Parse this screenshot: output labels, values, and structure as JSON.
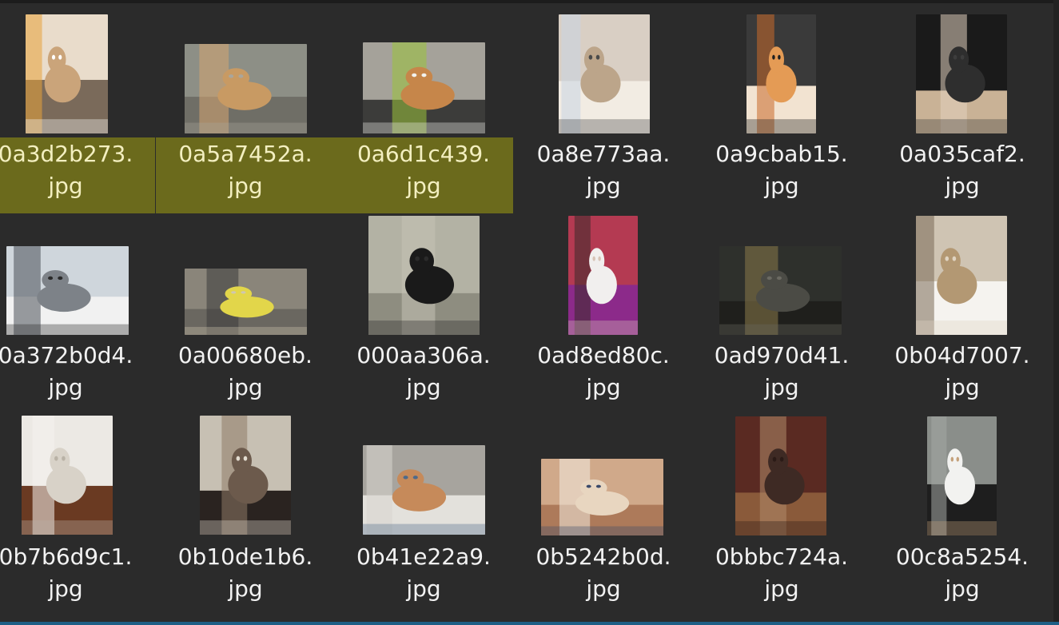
{
  "file_grid": {
    "selection_color": "#6b6a1c",
    "items": [
      {
        "name_line1": "0a3d2b273.",
        "name_line2": "jpg",
        "selected": true,
        "icon": "cat-thumbnail"
      },
      {
        "name_line1": "0a5a7452a.",
        "name_line2": "jpg",
        "selected": true,
        "icon": "dog-thumbnail"
      },
      {
        "name_line1": "0a6d1c439.",
        "name_line2": "jpg",
        "selected": true,
        "icon": "dog-thumbnail"
      },
      {
        "name_line1": "0a8e773aa.",
        "name_line2": "jpg",
        "selected": false,
        "icon": "cat-thumbnail"
      },
      {
        "name_line1": "0a9cbab15.",
        "name_line2": "jpg",
        "selected": false,
        "icon": "cat-thumbnail"
      },
      {
        "name_line1": "0a035caf2.",
        "name_line2": "jpg",
        "selected": false,
        "icon": "cat-thumbnail"
      },
      {
        "name_line1": "0a372b0d4.",
        "name_line2": "jpg",
        "selected": false,
        "icon": "cat-thumbnail"
      },
      {
        "name_line1": "0a00680eb.",
        "name_line2": "jpg",
        "selected": false,
        "icon": "cat-thumbnail"
      },
      {
        "name_line1": "000aa306a.",
        "name_line2": "jpg",
        "selected": false,
        "icon": "dog-thumbnail"
      },
      {
        "name_line1": "0ad8ed80c.",
        "name_line2": "jpg",
        "selected": false,
        "icon": "cat-thumbnail"
      },
      {
        "name_line1": "0ad970d41.",
        "name_line2": "jpg",
        "selected": false,
        "icon": "cat-thumbnail"
      },
      {
        "name_line1": "0b04d7007.",
        "name_line2": "jpg",
        "selected": false,
        "icon": "dog-thumbnail"
      },
      {
        "name_line1": "0b7b6d9c1.",
        "name_line2": "jpg",
        "selected": false,
        "icon": "dog-thumbnail"
      },
      {
        "name_line1": "0b10de1b6.",
        "name_line2": "jpg",
        "selected": false,
        "icon": "dog-thumbnail"
      },
      {
        "name_line1": "0b41e22a9.",
        "name_line2": "jpg",
        "selected": false,
        "icon": "dog-thumbnail"
      },
      {
        "name_line1": "0b5242b0d.",
        "name_line2": "jpg",
        "selected": false,
        "icon": "dog-thumbnail"
      },
      {
        "name_line1": "0bbbc724a.",
        "name_line2": "jpg",
        "selected": false,
        "icon": "dog-thumbnail"
      },
      {
        "name_line1": "00c8a5254.",
        "name_line2": "jpg",
        "selected": false,
        "icon": "dog-thumbnail"
      }
    ]
  }
}
